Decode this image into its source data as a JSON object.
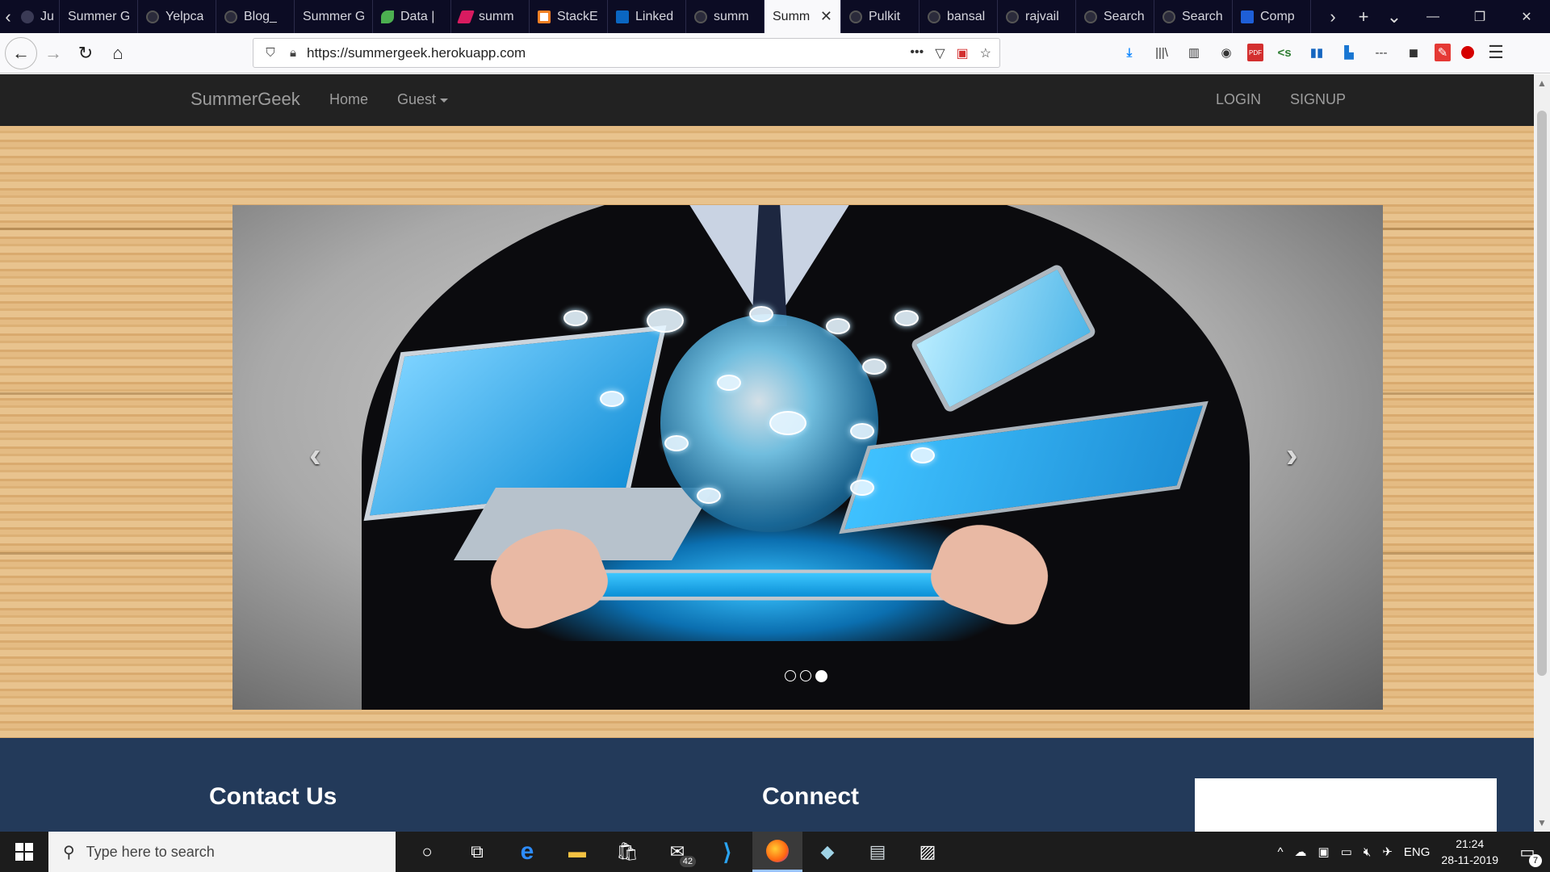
{
  "browser": {
    "tabs": [
      {
        "label": "Jul",
        "icon": "page-icon"
      },
      {
        "label": "Summer G",
        "icon": "page-icon"
      },
      {
        "label": "Yelpca",
        "icon": "github-icon"
      },
      {
        "label": "Blog_",
        "icon": "github-icon"
      },
      {
        "label": "Summer G",
        "icon": "page-icon"
      },
      {
        "label": "Data |",
        "icon": "leaf-icon"
      },
      {
        "label": "summ",
        "icon": "pink-icon"
      },
      {
        "label": "StackE",
        "icon": "stackexchange-icon"
      },
      {
        "label": "Linked",
        "icon": "linkedin-icon"
      },
      {
        "label": "summ",
        "icon": "github-icon"
      },
      {
        "label": "Summ",
        "icon": "page-icon",
        "active": true
      },
      {
        "label": "Pulkit",
        "icon": "github-icon"
      },
      {
        "label": "bansal",
        "icon": "github-icon"
      },
      {
        "label": "rajvail",
        "icon": "github-icon"
      },
      {
        "label": "Search",
        "icon": "github-icon"
      },
      {
        "label": "Search",
        "icon": "github-icon"
      },
      {
        "label": "Comp",
        "icon": "number2-icon"
      }
    ],
    "url": "https://summergeek.herokuapp.com"
  },
  "site": {
    "brand": "SummerGeek",
    "nav": {
      "home": "Home",
      "guest": "Guest",
      "login": "LOGIN",
      "signup": "SIGNUP"
    },
    "carousel": {
      "slide_count": 3,
      "active_index": 2
    },
    "footer": {
      "contact_heading": "Contact Us",
      "connect_heading": "Connect"
    }
  },
  "taskbar": {
    "search_placeholder": "Type here to search",
    "mail_badge": "42",
    "language": "ENG",
    "time": "21:24",
    "date": "28-11-2019",
    "notification_count": "7"
  },
  "colors": {
    "site_nav_bg": "#222222",
    "footer_bg": "#233a5a",
    "tabstrip_bg": "#0c0c24"
  }
}
